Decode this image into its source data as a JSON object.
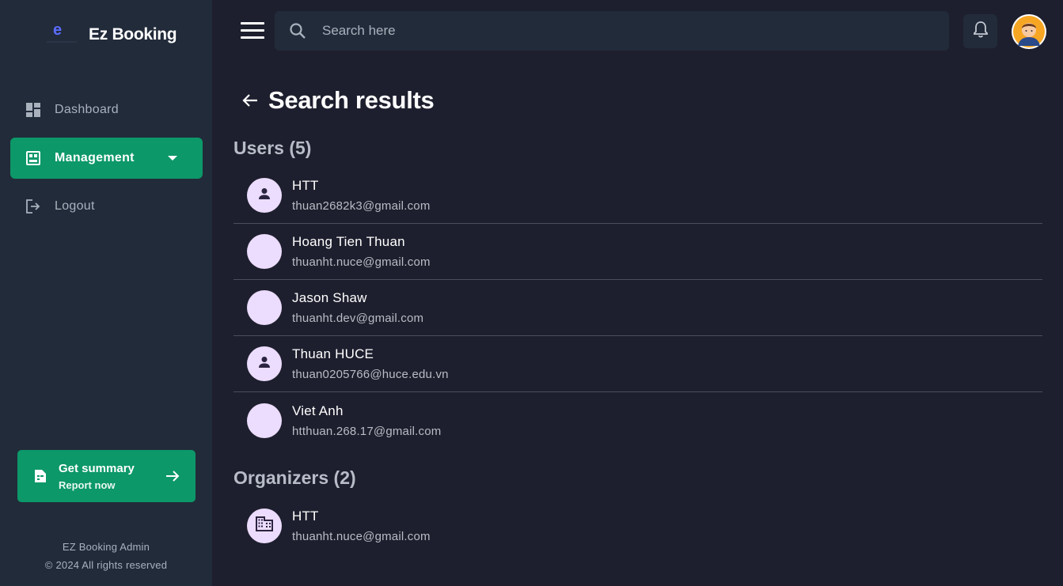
{
  "brand": {
    "name": "Ez Booking"
  },
  "sidebar": {
    "items": [
      {
        "label": "Dashboard",
        "icon": "dashboard-icon",
        "active": false
      },
      {
        "label": "Management",
        "icon": "management-icon",
        "active": true
      },
      {
        "label": "Logout",
        "icon": "logout-icon",
        "active": false
      }
    ],
    "summary": {
      "title": "Get summary",
      "subtitle": "Report now"
    },
    "footer": {
      "line1": "EZ Booking Admin",
      "line2": "© 2024 All rights reserved"
    }
  },
  "topbar": {
    "search_placeholder": "Search here"
  },
  "page": {
    "title": "Search results"
  },
  "users": {
    "title": "Users (5)",
    "items": [
      {
        "name": "HTT",
        "email": "thuan2682k3@gmail.com",
        "icon": "person-icon"
      },
      {
        "name": "Hoang Tien Thuan",
        "email": "thuanht.nuce@gmail.com",
        "icon": ""
      },
      {
        "name": "Jason Shaw",
        "email": "thuanht.dev@gmail.com",
        "icon": ""
      },
      {
        "name": "Thuan HUCE",
        "email": "thuan0205766@huce.edu.vn",
        "icon": "person-icon"
      },
      {
        "name": "Viet Anh",
        "email": "htthuan.268.17@gmail.com",
        "icon": ""
      }
    ]
  },
  "organizers": {
    "title": "Organizers (2)",
    "items": [
      {
        "name": "HTT",
        "email": "thuanht.nuce@gmail.com",
        "icon": "building-icon"
      }
    ]
  },
  "colors": {
    "background": "#1e1f2e",
    "sidebar": "#222b3a",
    "accent": "#0c9868",
    "avatar_bg": "#ecdcfd"
  }
}
